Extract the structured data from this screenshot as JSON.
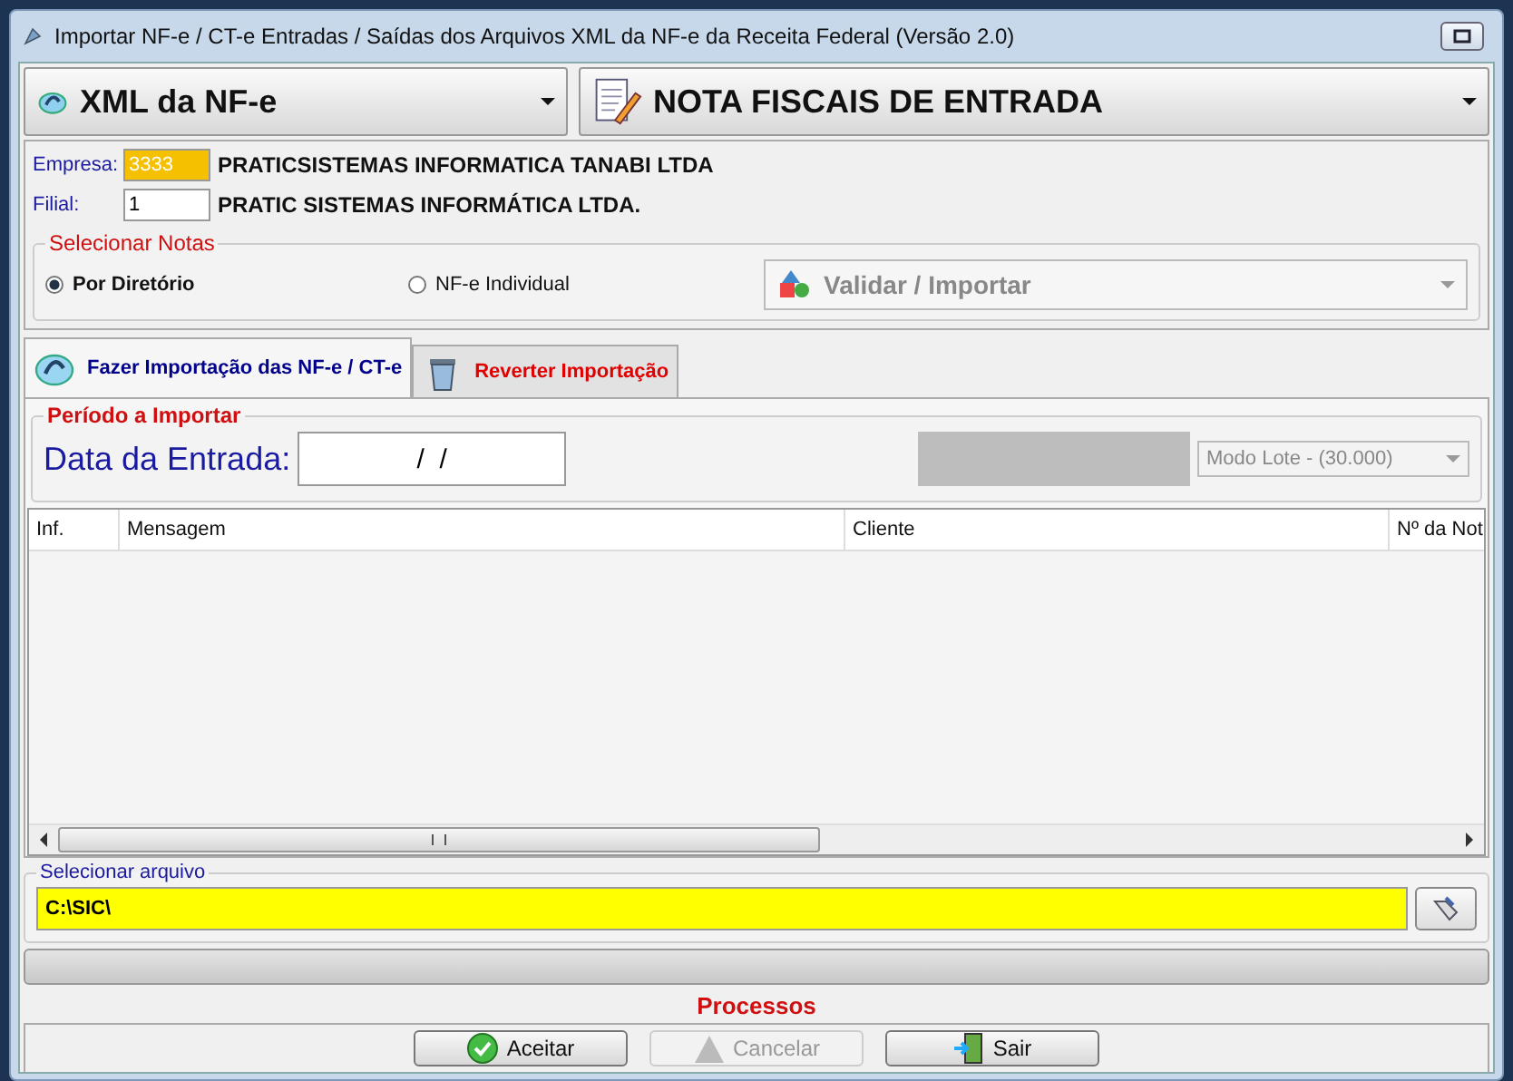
{
  "window": {
    "title": "Importar NF-e / CT-e Entradas / Saídas dos Arquivos XML da NF-e da Receita Federal (Versão 2.0)"
  },
  "combos": [
    {
      "label": "XML da NF-e",
      "kind": "xml"
    },
    {
      "label": "NOTA FISCAIS DE ENTRADA",
      "kind": "doc"
    }
  ],
  "empresa": {
    "label": "Empresa:",
    "code": "3333",
    "name": "PRATICSISTEMAS INFORMATICA TANABI LTDA"
  },
  "filial": {
    "label": "Filial:",
    "code": "1",
    "name": "PRATIC SISTEMAS INFORMÁTICA LTDA."
  },
  "selecionar_notas": {
    "title": "Selecionar Notas",
    "options": [
      {
        "label": "Por Diretório",
        "selected": true
      },
      {
        "label": "NF-e Individual",
        "selected": false
      }
    ],
    "action": {
      "label": "Validar / Importar",
      "disabled": true
    }
  },
  "tabs": [
    {
      "label": "Fazer Importação das NF-e / CT-e",
      "selected": true,
      "color": "#00008b",
      "kind": "nfe"
    },
    {
      "label": "Reverter Importação",
      "selected": false,
      "color": "#e00000",
      "kind": "trash"
    }
  ],
  "periodo": {
    "title": "Período a Importar",
    "date_label": "Data da Entrada:",
    "date_value": "/  /",
    "mode": {
      "label": "Modo Lote - (30.000)",
      "disabled": true
    }
  },
  "table": {
    "columns": [
      "Inf.",
      "Mensagem",
      "Cliente",
      "Nº da Not"
    ]
  },
  "arquivo": {
    "title": "Selecionar arquivo",
    "value": "C:\\SIC\\"
  },
  "progress": {
    "level": 0
  },
  "processos": "Processos",
  "buttons": [
    {
      "label": "Aceitar",
      "disabled": false,
      "kind": "ok"
    },
    {
      "label": "Cancelar",
      "disabled": true,
      "kind": "cancel"
    },
    {
      "label": "Sair",
      "disabled": false,
      "kind": "exit"
    }
  ]
}
